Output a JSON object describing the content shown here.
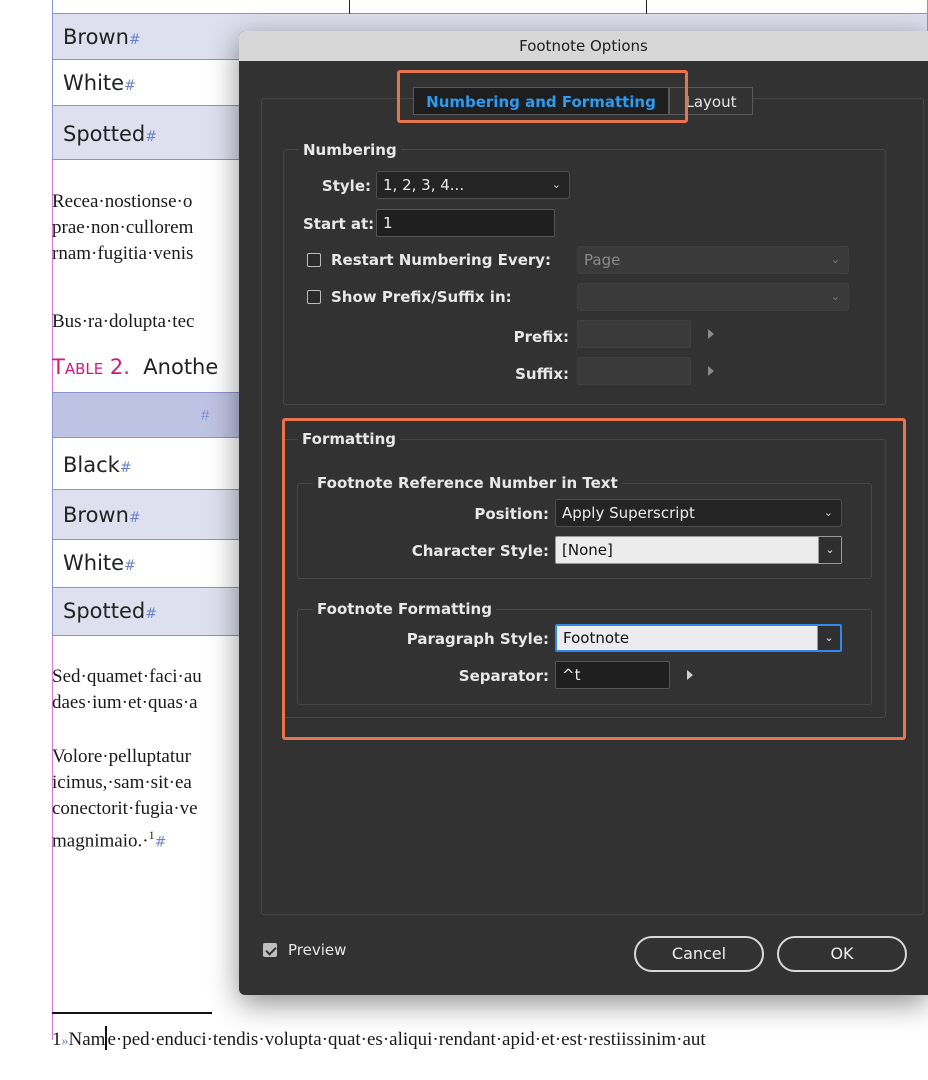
{
  "document": {
    "table1_rows": [
      {
        "label": "Brown",
        "mark": "#"
      },
      {
        "label": "White",
        "mark": "#"
      },
      {
        "label": "Spotted",
        "mark": "#"
      }
    ],
    "paragraph1_lines": [
      "Recea·nostionse·o",
      "prae·non·cullorem",
      "rnam·fugitia·venis"
    ],
    "paragraph2_line": "Bus·ra·dolupta·tec",
    "caption_label": "Table 2.",
    "caption_title": "Anothe",
    "table2_header_mark": "#",
    "table2_rows": [
      {
        "label": "Black",
        "mark": "#"
      },
      {
        "label": "Brown",
        "mark": "#"
      },
      {
        "label": "White",
        "mark": "#"
      },
      {
        "label": "Spotted",
        "mark": "#"
      }
    ],
    "paragraph3_lines": [
      "Sed·quamet·faci·au",
      "daes·ium·et·quas·a"
    ],
    "paragraph4_lines": [
      "Volore·pelluptatur",
      "icimus,·sam·sit·ea",
      "conectorit·fugia·ve"
    ],
    "paragraph4_last": "magnimaio.·",
    "footnote_ref": "1",
    "footnote_mark": "#",
    "footnote_num": "1",
    "footnote_sep": "»",
    "footnote_before_cursor": "Nam",
    "footnote_after_cursor": "e·ped·enduci·tendis·volupta·quat·es·aliqui·rendant·apid·et·est·restiissinim·aut"
  },
  "dialog": {
    "title": "Footnote Options",
    "tabs": [
      {
        "label": "Numbering and Formatting",
        "active": true
      },
      {
        "label": "Layout",
        "active": false
      }
    ],
    "numbering": {
      "group_label": "Numbering",
      "style_label": "Style:",
      "style_value": "1, 2, 3, 4...",
      "start_label": "Start at:",
      "start_value": "1",
      "restart_label": "Restart Numbering Every:",
      "restart_checked": false,
      "restart_value": "Page",
      "prefix_suffix_label": "Show Prefix/Suffix in:",
      "prefix_suffix_checked": false,
      "prefix_suffix_value": "",
      "prefix_label": "Prefix:",
      "prefix_value": "",
      "suffix_label": "Suffix:",
      "suffix_value": ""
    },
    "formatting": {
      "group_label": "Formatting",
      "ref_group_label": "Footnote Reference Number in Text",
      "position_label": "Position:",
      "position_value": "Apply Superscript",
      "char_style_label": "Character Style:",
      "char_style_value": "[None]",
      "fn_group_label": "Footnote Formatting",
      "para_style_label": "Paragraph Style:",
      "para_style_value": "Footnote",
      "separator_label": "Separator:",
      "separator_value": "^t"
    },
    "preview_label": "Preview",
    "preview_checked": true,
    "cancel_label": "Cancel",
    "ok_label": "OK"
  },
  "colors": {
    "highlight": "#e8734f",
    "active_tab_text": "#2d9bf0",
    "caption_label": "#d0177d"
  }
}
